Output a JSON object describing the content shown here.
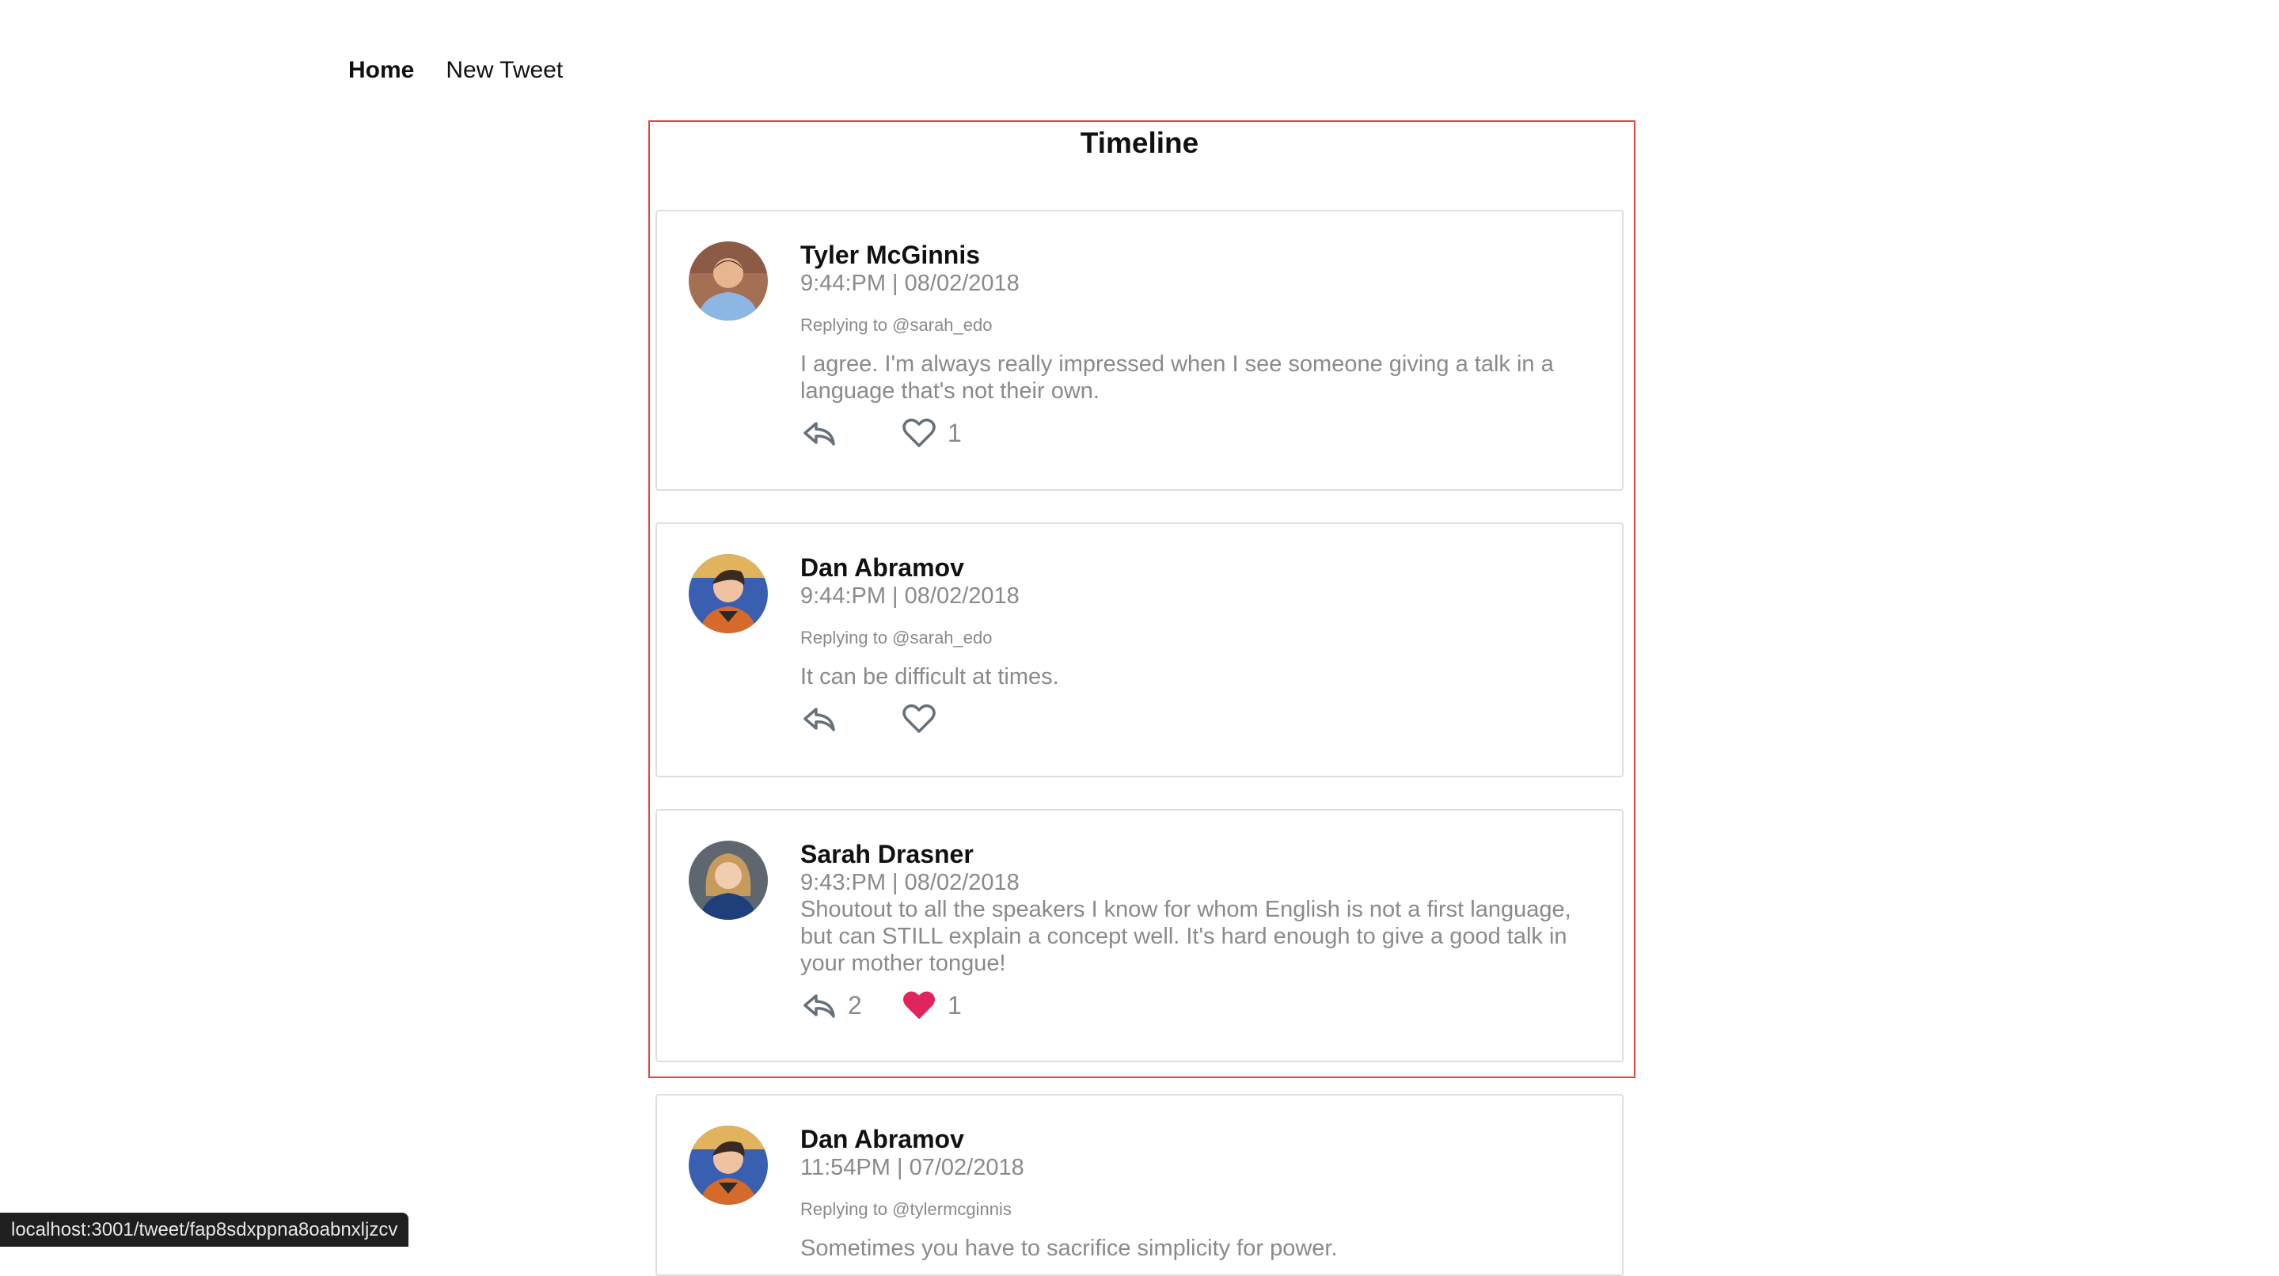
{
  "nav": {
    "home_label": "Home",
    "new_tweet_label": "New Tweet"
  },
  "timeline": {
    "title": "Timeline"
  },
  "tweets": [
    {
      "author": "Tyler McGinnis",
      "time": "9:44:PM | 08/02/2018",
      "replying_to": "Replying to @sarah_edo",
      "text": "I agree. I'm always really impressed when I see someone giving a talk in a language that's not their own.",
      "reply_count": "",
      "like_count": "1",
      "liked": false
    },
    {
      "author": "Dan Abramov",
      "time": "9:44:PM | 08/02/2018",
      "replying_to": "Replying to @sarah_edo",
      "text": "It can be difficult at times.",
      "reply_count": "",
      "like_count": "",
      "liked": false
    },
    {
      "author": "Sarah Drasner",
      "time": "9:43:PM | 08/02/2018",
      "replying_to": "",
      "text": "Shoutout to all the speakers I know for whom English is not a first language, but can STILL explain a concept well. It's hard enough to give a good talk in your mother tongue!",
      "reply_count": "2",
      "like_count": "1",
      "liked": true
    },
    {
      "author": "Dan Abramov",
      "time": "11:54PM | 07/02/2018",
      "replying_to": "Replying to @tylermcginnis",
      "text": "Sometimes you have to sacrifice simplicity for power.",
      "reply_count": "",
      "like_count": "",
      "liked": false
    }
  ],
  "status_bar": {
    "url": "localhost:3001/tweet/fap8sdxppna8oabnxljzcv"
  },
  "colors": {
    "frame_border": "#e2453c",
    "liked_heart": "#e0245e",
    "muted_text": "#8a8a8a"
  },
  "icons": {
    "reply": "reply-arrow-icon",
    "like": "heart-outline-icon",
    "liked": "heart-filled-icon"
  }
}
